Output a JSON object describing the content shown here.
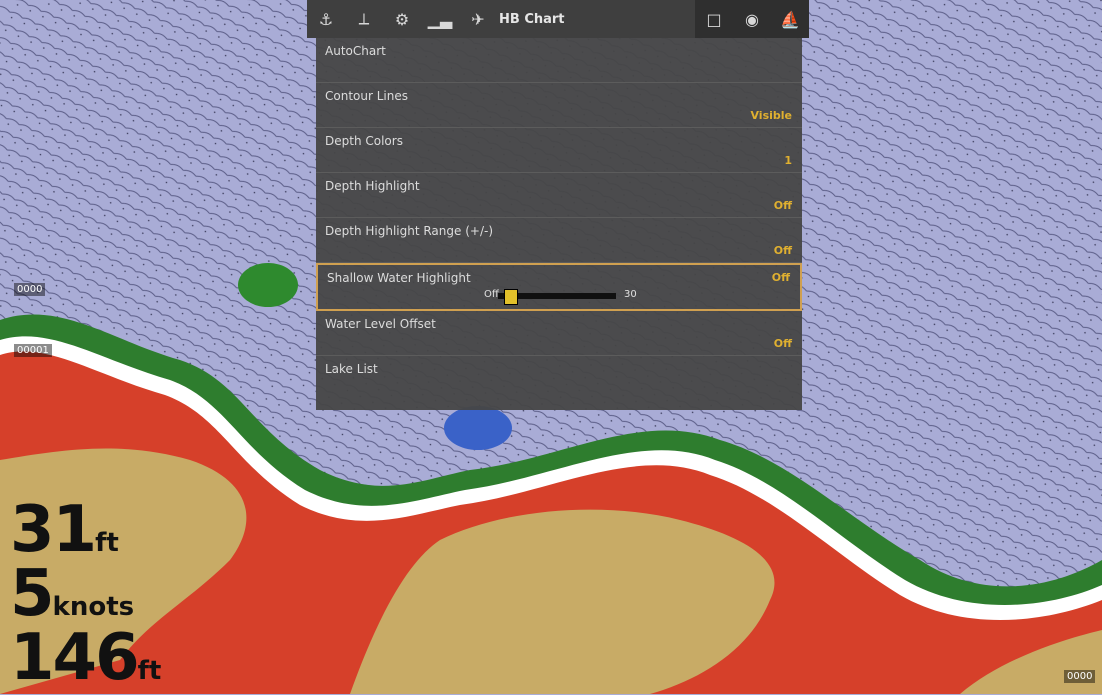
{
  "topbar": {
    "title": "HB Chart",
    "icons": [
      "anchor-icon",
      "navigation-icon",
      "settings-icon",
      "signal-icon",
      "waypoint-icon",
      "window-icon",
      "target-icon",
      "boat-icon"
    ]
  },
  "menu": {
    "items": [
      {
        "label": "AutoChart",
        "value": ""
      },
      {
        "label": "Contour Lines",
        "value": "Visible"
      },
      {
        "label": "Depth Colors",
        "value": "1"
      },
      {
        "label": "Depth Highlight",
        "value": "Off"
      },
      {
        "label": "Depth Highlight Range (+/-)",
        "value": "Off"
      },
      {
        "label": "Shallow Water Highlight",
        "value": "Off"
      },
      {
        "label": "Water Level Offset",
        "value": "Off"
      },
      {
        "label": "Lake List",
        "value": ""
      }
    ],
    "slider": {
      "min_label": "Off",
      "max_label": "30",
      "level": 0.05
    }
  },
  "readouts": {
    "depth": {
      "value": "31",
      "unit": "ft"
    },
    "speed": {
      "value": "5",
      "unit": "knots"
    },
    "temp": {
      "value": "146",
      "unit": "ft"
    }
  },
  "map_labels": {
    "tag_a": "0000",
    "tag_b": "00001",
    "bottom_right": "0000"
  },
  "colors": {
    "land": "#c8ab66",
    "water": "#a9acd6",
    "shallow": "#2f8a2f",
    "highlight": "#e0b030"
  }
}
